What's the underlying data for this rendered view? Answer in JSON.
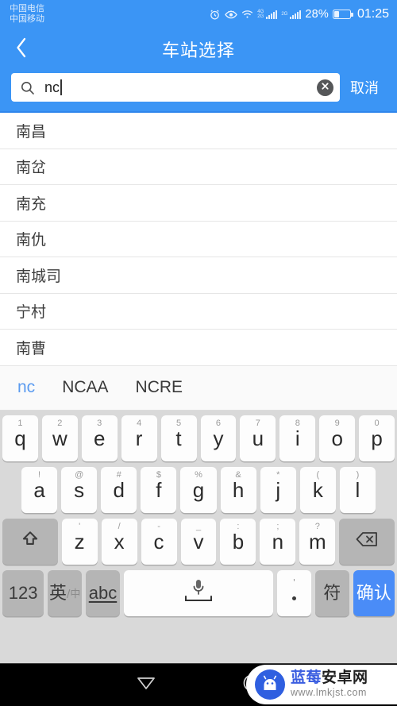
{
  "status_bar": {
    "carrier_1": "中国电信",
    "carrier_2": "中国移动",
    "net_label_1": "4G",
    "net_label_2": "2G",
    "net_label_3": "2G",
    "battery_percent": "28%",
    "clock": "01:25",
    "icons": [
      "alarm-icon",
      "eye-icon",
      "wifi-icon",
      "signal-icon",
      "signal-icon",
      "battery-icon"
    ]
  },
  "header": {
    "title": "车站选择",
    "back_icon": "chevron-left-icon"
  },
  "search": {
    "value": "nc",
    "icon": "search-icon",
    "clear_icon": "clear-circle-icon",
    "cancel_label": "取消"
  },
  "results": [
    {
      "name": "南昌"
    },
    {
      "name": "南岔"
    },
    {
      "name": "南充"
    },
    {
      "name": "南仇"
    },
    {
      "name": "南城司"
    },
    {
      "name": "宁村"
    },
    {
      "name": "南曹"
    }
  ],
  "candidates": [
    {
      "text": "nc",
      "active": true
    },
    {
      "text": "NCAA",
      "active": false
    },
    {
      "text": "NCRE",
      "active": false
    }
  ],
  "keyboard": {
    "row1": [
      {
        "sup": "1",
        "main": "q"
      },
      {
        "sup": "2",
        "main": "w"
      },
      {
        "sup": "3",
        "main": "e"
      },
      {
        "sup": "4",
        "main": "r"
      },
      {
        "sup": "5",
        "main": "t"
      },
      {
        "sup": "6",
        "main": "y"
      },
      {
        "sup": "7",
        "main": "u"
      },
      {
        "sup": "8",
        "main": "i"
      },
      {
        "sup": "9",
        "main": "o"
      },
      {
        "sup": "0",
        "main": "p"
      }
    ],
    "row2": [
      {
        "sup": "!",
        "main": "a"
      },
      {
        "sup": "@",
        "main": "s"
      },
      {
        "sup": "#",
        "main": "d"
      },
      {
        "sup": "$",
        "main": "f"
      },
      {
        "sup": "%",
        "main": "g"
      },
      {
        "sup": "&",
        "main": "h"
      },
      {
        "sup": "*",
        "main": "j"
      },
      {
        "sup": "(",
        "main": "k"
      },
      {
        "sup": ")",
        "main": "l"
      }
    ],
    "row3": [
      {
        "sup": "'",
        "main": "z"
      },
      {
        "sup": "/",
        "main": "x"
      },
      {
        "sup": "-",
        "main": "c"
      },
      {
        "sup": "_",
        "main": "v"
      },
      {
        "sup": ":",
        "main": "b"
      },
      {
        "sup": ";",
        "main": "n"
      },
      {
        "sup": "?",
        "main": "m"
      }
    ],
    "shift_icon": "shift-arrow-icon",
    "backspace_icon": "backspace-icon",
    "row4": {
      "numeric_label": "123",
      "lang_main": "英",
      "lang_sub": "/中",
      "abc_label": "abc",
      "space_icon": "microphone-icon",
      "comma_sup": "'",
      "comma_main": "period-dot",
      "symbol_label": "符",
      "confirm_label": "确认"
    }
  },
  "navbar": {
    "back_icon": "triangle-back-icon",
    "home_icon": "circle-home-icon"
  },
  "watermark": {
    "logo_icon": "android-robot-icon",
    "title_part_1": "蓝莓",
    "title_part_2": "安卓网",
    "url": "www.lmkjst.com"
  },
  "colors": {
    "brand_blue": "#3b95f5",
    "key_blue": "#4a8cf7",
    "keyboard_bg": "#d9d9d9",
    "candidate_active": "#5b9bf0"
  }
}
